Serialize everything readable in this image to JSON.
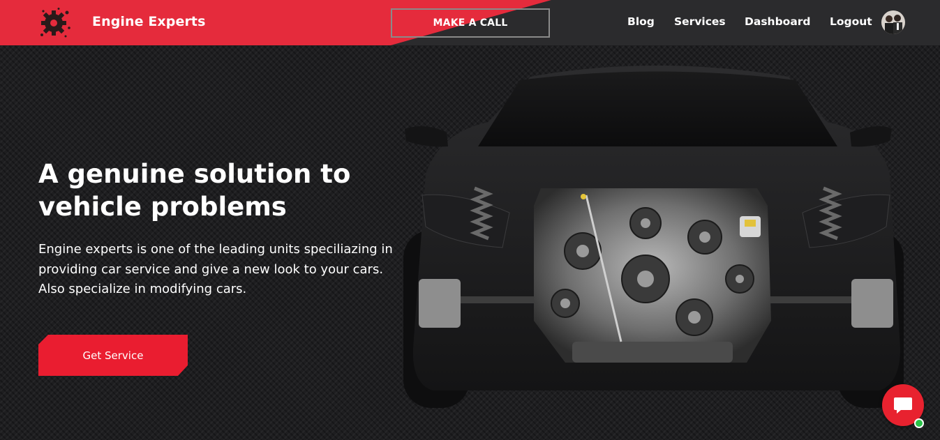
{
  "navbar": {
    "brand": "Engine Experts",
    "call_label": "MAKE A CALL",
    "links": [
      "Blog",
      "Services",
      "Dashboard",
      "Logout"
    ],
    "accent_color": "#e52b3c"
  },
  "hero": {
    "headline_line1": "A genuine solution to",
    "headline_line2": "vehicle problems",
    "description": "Engine experts is one of the leading units speciliazing in providing car service and give a new look to your cars. Also specialize in modifying cars.",
    "cta_label": "Get Service"
  },
  "icons": {
    "logo": "gear-splash-icon",
    "avatar": "user-avatar",
    "chat": "chat-bubble-icon",
    "status": "online-status-dot"
  }
}
